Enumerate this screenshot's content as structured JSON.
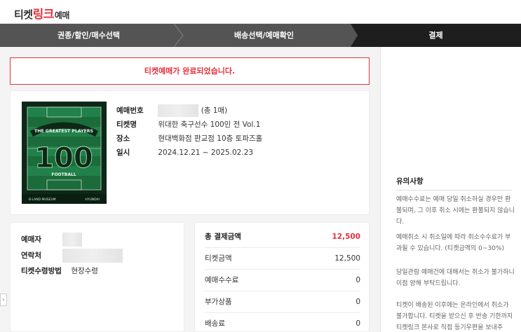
{
  "logo": {
    "part1": "티켓",
    "part2": "링크",
    "part3": "예매"
  },
  "steps": [
    {
      "label": "권종/할인/매수선택"
    },
    {
      "label": "배송선택/예매확인"
    },
    {
      "label": "결제"
    }
  ],
  "notice": "티켓예매가 완료되었습니다.",
  "ticket": {
    "reservation_label": "예매번호",
    "reservation_count": "(총 1매)",
    "name_label": "티켓명",
    "name_value": "위대한 축구선수 100인 전 Vol.1",
    "place_label": "장소",
    "place_value": "현대백화점 판교점 10층 토파즈홀",
    "date_label": "일시",
    "date_value": "2024.12.21 ~ 2025.02.23"
  },
  "poster": {
    "line1": "THE GREATEST PLAYERS",
    "number": "100",
    "line2": "FOOTBALL",
    "brand_left": "B·LAND MUSEUM",
    "brand_right": "HYUNDAI"
  },
  "buyer": {
    "buyer_label": "예매자",
    "contact_label": "연락처",
    "method_label": "티켓수령방법",
    "method_value": "현장수령"
  },
  "payment": {
    "rows": [
      {
        "label": "총 결제금액",
        "value": "12,500"
      },
      {
        "label": "티켓금액",
        "value": "12,500"
      },
      {
        "label": "예매수수료",
        "value": "0"
      },
      {
        "label": "부가상품",
        "value": "0"
      },
      {
        "label": "배송료",
        "value": "0"
      }
    ]
  },
  "side": {
    "title": "유의사항",
    "p1": "예매수수료는 예매 당일 취소하실 경우만 환불되며, 그 이후 취소 시에는 환불되지 않습니다.",
    "p2": "예매취소 시 취소일에 따라 취소수수료가 부과될 수 있습니다. (티켓금액의 0~30%)",
    "p3": "당일관람 예매건에 대해서는 취소가 불가하니 이점 양해 부탁드립니다.",
    "p4": "티켓이 배송된 이후에는 온라인에서 취소가 불가합니다. 티켓을 받으신 후 반송 기한까지 티켓링크 본사로 직접 등기우편을 보내주"
  },
  "colors": {
    "accent": "#e8303c",
    "step_bg": "#545454",
    "step_active": "#1e1e1e"
  }
}
